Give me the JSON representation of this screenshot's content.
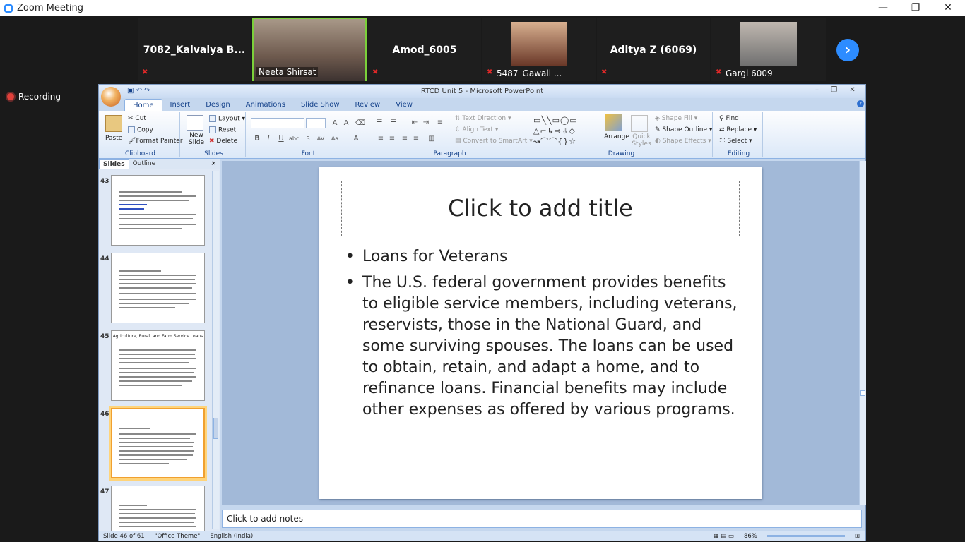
{
  "zoom": {
    "title": "Zoom Meeting",
    "recording": "Recording",
    "participants": [
      {
        "name": "7082_Kaivalya B...",
        "label": ""
      },
      {
        "name": "",
        "label": "Neeta Shirsat"
      },
      {
        "name": "Amod_6005",
        "label": ""
      },
      {
        "name": "",
        "label": "5487_Gawali ..."
      },
      {
        "name": "Aditya Z (6069)",
        "label": ""
      },
      {
        "name": "",
        "label": "Gargi 6009"
      }
    ],
    "next_icon": "chevron-right-icon",
    "minimize": "—",
    "restore": "❐",
    "close": "✕"
  },
  "ppt": {
    "title": "RTCD Unit 5 - Microsoft PowerPoint",
    "tabs": [
      "Home",
      "Insert",
      "Design",
      "Animations",
      "Slide Show",
      "Review",
      "View"
    ],
    "clipboard": {
      "paste": "Paste",
      "cut": "Cut",
      "copy": "Copy",
      "painter": "Format Painter",
      "label": "Clipboard"
    },
    "slides_group": {
      "new_slide": "New Slide",
      "layout": "Layout",
      "reset": "Reset",
      "delete": "Delete",
      "label": "Slides"
    },
    "font_group": {
      "label": "Font"
    },
    "paragraph_group": {
      "text_direction": "Text Direction",
      "align_text": "Align Text",
      "smartart": "Convert to SmartArt",
      "label": "Paragraph"
    },
    "drawing_group": {
      "arrange": "Arrange",
      "quick_styles": "Quick Styles",
      "shape_fill": "Shape Fill",
      "shape_outline": "Shape Outline",
      "shape_effects": "Shape Effects",
      "label": "Drawing"
    },
    "editing_group": {
      "find": "Find",
      "replace": "Replace",
      "select": "Select",
      "label": "Editing"
    },
    "panel_tabs": [
      "Slides",
      "Outline"
    ],
    "thumbs": [
      {
        "num": "43",
        "title": ""
      },
      {
        "num": "44",
        "title": ""
      },
      {
        "num": "45",
        "title": "Agriculture, Rural, and Farm Service Loans"
      },
      {
        "num": "46",
        "title": ""
      },
      {
        "num": "47",
        "title": ""
      }
    ],
    "slide": {
      "title": "Click to add title",
      "bullets": [
        "Loans for Veterans",
        "The U.S. federal government provides benefits to eligible  service members, including veterans, reservists, those in the National Guard, and some surviving spouses. The loans can be used to obtain, retain, and adapt a home, and to refinance loans. Financial benefits may include other expenses  as offered by various programs."
      ]
    },
    "notes": "Click to add notes",
    "status": {
      "slide": "Slide 46 of 61",
      "theme": "\"Office Theme\"",
      "lang": "English (India)",
      "zoom": "86%"
    }
  }
}
